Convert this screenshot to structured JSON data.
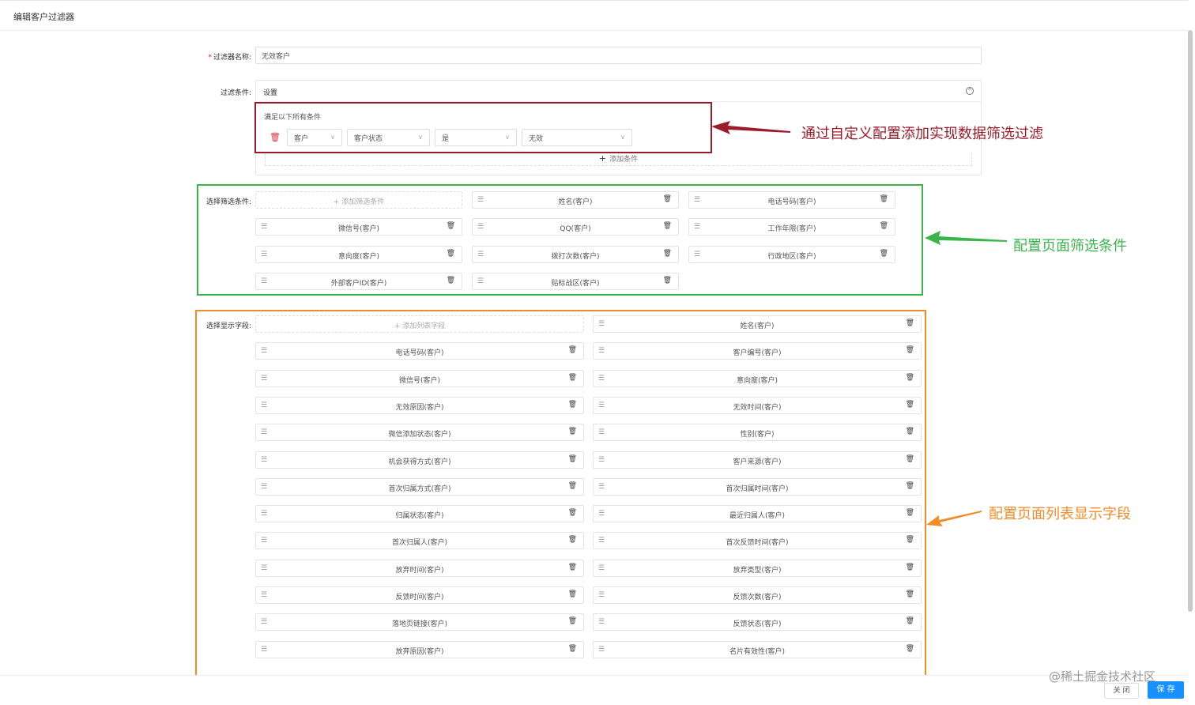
{
  "header": {
    "title": "编辑客户过滤器"
  },
  "form": {
    "name_label": "过滤器名称:",
    "name_required_mark": "*",
    "name_value": "无效客户",
    "cond_label": "过滤条件:",
    "cond_panel_title": "设置",
    "cond_hint": "满足以下所有条件",
    "cond_row": [
      "客户",
      "客户状态",
      "是",
      "无效"
    ],
    "add_condition": "添加条件",
    "filter_label": "选择筛选条件:",
    "add_filter": "添加筛选条件",
    "filters": [
      "姓名(客户)",
      "电话号码(客户)",
      "微信号(客户)",
      "QQ(客户)",
      "工作年限(客户)",
      "意向度(客户)",
      "拨打次数(客户)",
      "行政地区(客户)",
      "外部客户ID(客户)",
      "贴标战区(客户)"
    ],
    "display_label": "选择显示字段:",
    "add_display": "添加列表字段",
    "display_fields": [
      "姓名(客户)",
      "电话号码(客户)",
      "客户编号(客户)",
      "微信号(客户)",
      "意向度(客户)",
      "无效原因(客户)",
      "无效时间(客户)",
      "微信添加状态(客户)",
      "性别(客户)",
      "机会获得方式(客户)",
      "客户来源(客户)",
      "首次归属方式(客户)",
      "首次归属时间(客户)",
      "归属状态(客户)",
      "最近归属人(客户)",
      "首次归属人(客户)",
      "首次反馈时间(客户)",
      "放弃时间(客户)",
      "放弃类型(客户)",
      "反馈时间(客户)",
      "反馈次数(客户)",
      "落地页链接(客户)",
      "反馈状态(客户)",
      "放弃原因(客户)",
      "名片有效性(客户)"
    ]
  },
  "annotations": {
    "red": "通过自定义配置添加实现数据筛选过滤",
    "green": "配置页面筛选条件",
    "orange": "配置页面列表显示字段",
    "red_color": "#9c1b2b",
    "green_color": "#3ab54a",
    "orange_color": "#f28c28"
  },
  "footer": {
    "close": "关 闭",
    "save": "保 存"
  },
  "watermark": "@稀土掘金技术社区",
  "colors": {
    "primary": "#1890ff"
  }
}
